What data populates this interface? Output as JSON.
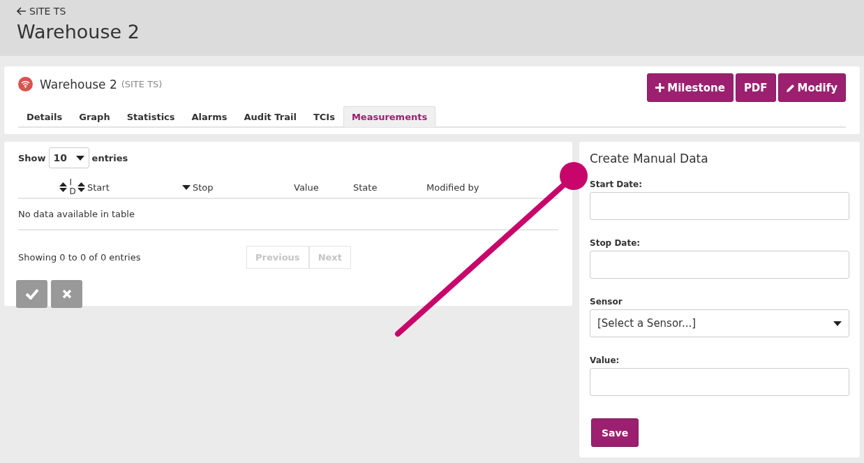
{
  "header": {
    "back_link": "SITE TS",
    "title": "Warehouse 2"
  },
  "site": {
    "name": "Warehouse 2",
    "parent": "(SITE TS)",
    "color": "#d9534f"
  },
  "actions": [
    {
      "kind": "add",
      "label": "Milestone"
    },
    {
      "kind": "plain",
      "label": "PDF"
    },
    {
      "kind": "edit",
      "label": "Modify"
    }
  ],
  "tabs": [
    {
      "label": "Details",
      "selected": false
    },
    {
      "label": "Graph",
      "selected": false
    },
    {
      "label": "Statistics",
      "selected": false
    },
    {
      "label": "Alarms",
      "selected": false
    },
    {
      "label": "Audit Trail",
      "selected": false
    },
    {
      "label": "TCIs",
      "selected": false
    },
    {
      "label": "Measurements",
      "selected": true
    }
  ],
  "table": {
    "length_label_before": "Show",
    "length_value": "10",
    "length_label_after": "entries",
    "columns": [
      {
        "label": "ID",
        "kind": "sortable"
      },
      {
        "label": "Start",
        "kind": "sortable"
      },
      {
        "label": "Stop",
        "kind": "sorted"
      },
      {
        "label": "Value",
        "kind": "plain"
      },
      {
        "label": "State",
        "kind": "plain"
      },
      {
        "label": "Modified by",
        "kind": "plain"
      }
    ],
    "empty_message": "No data available in table",
    "info": "Showing 0 to 0 of 0 entries",
    "pager": [
      {
        "label": "Previous",
        "disabled": true
      },
      {
        "label": "Next",
        "disabled": true
      }
    ],
    "row_actions": [
      {
        "kind": "confirm",
        "disabled": true
      },
      {
        "kind": "cancel",
        "disabled": true
      }
    ]
  },
  "form": {
    "title": "Create Manual Data",
    "fields": [
      {
        "kind": "text",
        "label": "Start Date:"
      },
      {
        "kind": "text",
        "label": "Stop Date:"
      },
      {
        "kind": "select",
        "label": "Sensor",
        "value": "[Select a Sensor...]"
      },
      {
        "kind": "text",
        "label": "Value:"
      }
    ],
    "submit": "Save"
  }
}
